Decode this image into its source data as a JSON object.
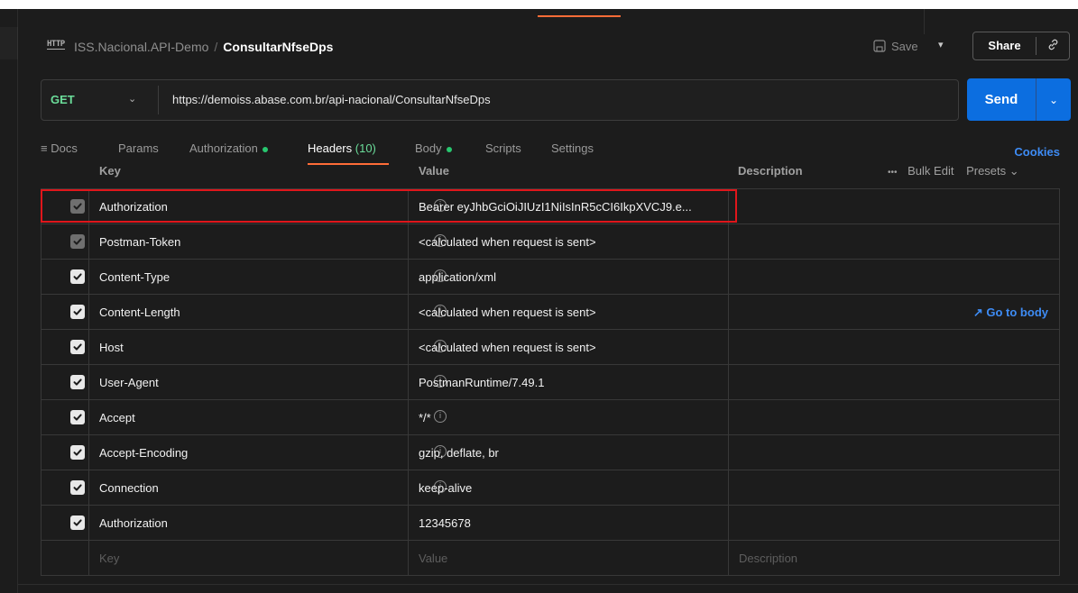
{
  "breadcrumb": {
    "icon": "http-icon",
    "icon_text": "HTTP",
    "collection": "ISS.Nacional.API-Demo",
    "separator": "/",
    "request": "ConsultarNfseDps"
  },
  "header": {
    "save_label": "Save",
    "share_label": "Share"
  },
  "request": {
    "method": "GET",
    "url": "https://demoiss.abase.com.br/api-nacional/ConsultarNfseDps",
    "send_label": "Send"
  },
  "tabs": {
    "docs": "Docs",
    "params": "Params",
    "authorization": "Authorization",
    "headers": "Headers",
    "headers_count": "(10)",
    "body": "Body",
    "scripts": "Scripts",
    "settings": "Settings",
    "cookies": "Cookies",
    "active": "Headers"
  },
  "columns": {
    "key": "Key",
    "value": "Value",
    "description": "Description",
    "bulk_edit": "Bulk Edit",
    "presets": "Presets"
  },
  "headers": [
    {
      "key": "Authorization",
      "value": "Bearer eyJhbGciOiJIUzI1NiIsInR5cCI6IkpXVCJ9.e...",
      "checked": true,
      "auto": true,
      "info": true
    },
    {
      "key": "Postman-Token",
      "value": "<calculated when request is sent>",
      "checked": true,
      "auto": true,
      "info": true
    },
    {
      "key": "Content-Type",
      "value": "application/xml",
      "checked": true,
      "auto": false,
      "info": true
    },
    {
      "key": "Content-Length",
      "value": "<calculated when request is sent>",
      "checked": true,
      "auto": false,
      "info": true,
      "link": "Go to body"
    },
    {
      "key": "Host",
      "value": "<calculated when request is sent>",
      "checked": true,
      "auto": false,
      "info": true
    },
    {
      "key": "User-Agent",
      "value": "PostmanRuntime/7.49.1",
      "checked": true,
      "auto": false,
      "info": true
    },
    {
      "key": "Accept",
      "value": "*/*",
      "checked": true,
      "auto": false,
      "info": true
    },
    {
      "key": "Accept-Encoding",
      "value": "gzip, deflate, br",
      "checked": true,
      "auto": false,
      "info": true
    },
    {
      "key": "Connection",
      "value": "keep-alive",
      "checked": true,
      "auto": false,
      "info": true
    },
    {
      "key": "Authorization",
      "value": "12345678",
      "checked": true,
      "auto": false,
      "info": false
    }
  ],
  "new_row": {
    "key_placeholder": "Key",
    "value_placeholder": "Value",
    "description_placeholder": "Description"
  },
  "colors": {
    "accent": "#ff6c37",
    "send": "#0c6ee0",
    "method": "#6bdd9a",
    "link": "#3e8cf5",
    "highlight": "#e0161b"
  }
}
